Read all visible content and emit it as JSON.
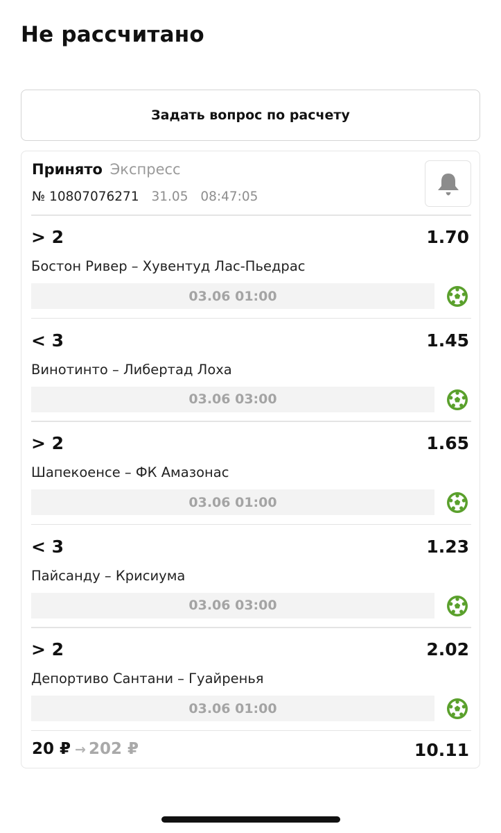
{
  "page": {
    "title": "Не рассчитано"
  },
  "ask_button": {
    "label": "Задать вопрос по расчету"
  },
  "bet": {
    "status": "Принято",
    "type": "Экспресс",
    "number": "№ 10807076271",
    "date": "31.05",
    "time": "08:47:05",
    "bell_icon": "bell-icon",
    "events": [
      {
        "outcome": "> 2",
        "odds": "1.70",
        "teams": "Бостон Ривер – Хувентуд Лас-Пьедрас",
        "datetime": "03.06 01:00",
        "sport_icon": "soccer-ball-icon"
      },
      {
        "outcome": "< 3",
        "odds": "1.45",
        "teams": "Винотинто – Либертад Лоха",
        "datetime": "03.06 03:00",
        "sport_icon": "soccer-ball-icon"
      },
      {
        "outcome": "> 2",
        "odds": "1.65",
        "teams": "Шапекоенсе – ФК Амазонас",
        "datetime": "03.06 01:00",
        "sport_icon": "soccer-ball-icon"
      },
      {
        "outcome": "< 3",
        "odds": "1.23",
        "teams": "Пайсанду – Крисиума",
        "datetime": "03.06 03:00",
        "sport_icon": "soccer-ball-icon"
      },
      {
        "outcome": "> 2",
        "odds": "2.02",
        "teams": "Депортиво Сантани – Гуайренья",
        "datetime": "03.06 01:00",
        "sport_icon": "soccer-ball-icon"
      }
    ],
    "stake": "20 ₽",
    "arrow": "→",
    "payout": "202 ₽",
    "total_odds": "10.11"
  },
  "colors": {
    "soccer_icon": "#5aa02c",
    "muted_text": "#9a9a9a",
    "date_bar": "#f3f3f3"
  }
}
